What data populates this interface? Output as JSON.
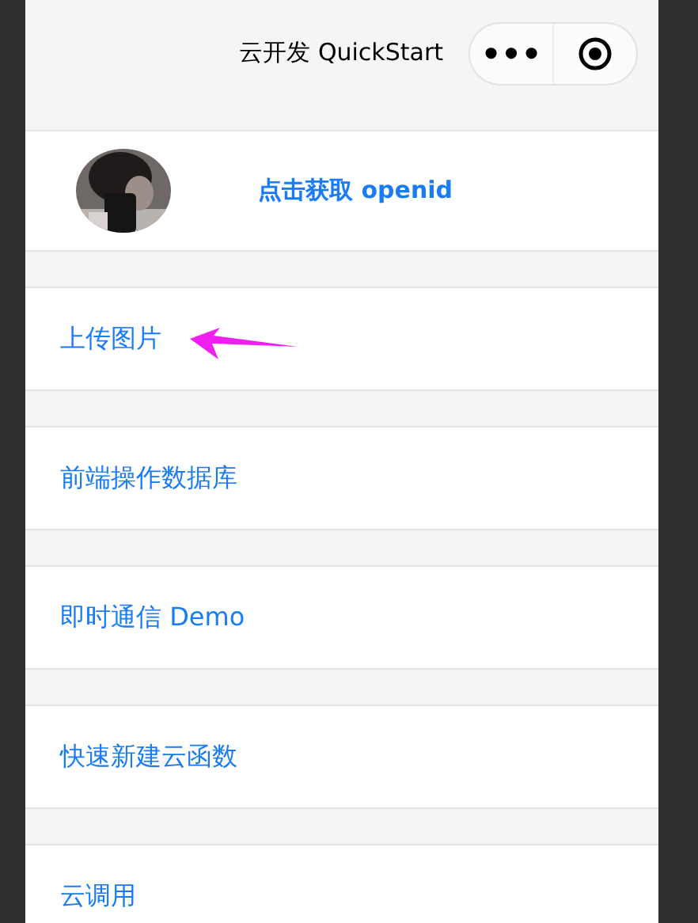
{
  "nav_bar": {
    "title": "云开发 QuickStart",
    "menu_button": "•••"
  },
  "user": {
    "openid_button": "点击获取 openid"
  },
  "menu_items": [
    {
      "label": "上传图片",
      "annotated": true
    },
    {
      "label": "前端操作数据库",
      "annotated": false
    },
    {
      "label": "即时通信 Demo",
      "annotated": false
    },
    {
      "label": "快速新建云函数",
      "annotated": false
    },
    {
      "label": "云调用",
      "annotated": false
    }
  ]
}
